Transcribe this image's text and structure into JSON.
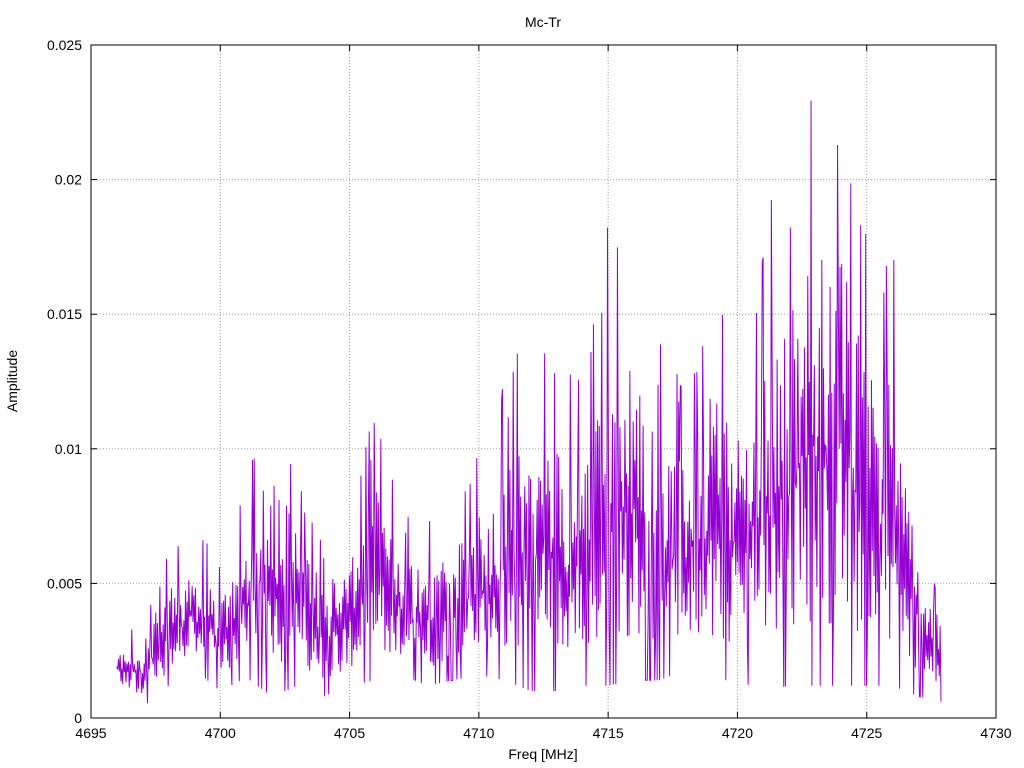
{
  "chart_data": {
    "type": "line",
    "title": "Mc-Tr",
    "xlabel": "Freq [MHz]",
    "ylabel": "Amplitude",
    "xlim": [
      4695,
      4730
    ],
    "ylim": [
      0,
      0.025
    ],
    "x_ticks": [
      "4695",
      "4700",
      "4705",
      "4710",
      "4715",
      "4720",
      "4725",
      "4730"
    ],
    "y_ticks": [
      "0",
      "0.005",
      "0.01",
      "0.015",
      "0.02",
      "0.025"
    ],
    "grid": true,
    "series": [
      {
        "color": "#9400d3",
        "x_start": 4696.0,
        "x_step": 0.032,
        "envelope_x": [
          4696.0,
          4697.0,
          4698.0,
          4699.0,
          4700.0,
          4701.0,
          4702.0,
          4703.0,
          4704.0,
          4705.0,
          4706.0,
          4707.0,
          4708.0,
          4709.0,
          4710.0,
          4711.0,
          4712.0,
          4713.0,
          4714.0,
          4715.0,
          4716.0,
          4717.0,
          4718.0,
          4719.0,
          4720.0,
          4721.0,
          4722.0,
          4723.0,
          4724.0,
          4725.0,
          4726.0,
          4727.0,
          4727.9
        ],
        "envelope_min": [
          0.001,
          0.0004,
          0.0012,
          0.0018,
          0.001,
          0.0015,
          0.0008,
          0.0012,
          0.0008,
          0.0012,
          0.0014,
          0.0016,
          0.0012,
          0.0014,
          0.0016,
          0.0014,
          0.001,
          0.001,
          0.0012,
          0.0012,
          0.0014,
          0.0014,
          0.0018,
          0.0014,
          0.0014,
          0.001,
          0.0012,
          0.0012,
          0.0012,
          0.0012,
          0.0012,
          0.0008,
          0.0006
        ],
        "envelope_max": [
          0.003,
          0.004,
          0.0065,
          0.007,
          0.006,
          0.0088,
          0.0132,
          0.0095,
          0.0068,
          0.0075,
          0.0118,
          0.0078,
          0.0078,
          0.0085,
          0.0101,
          0.0125,
          0.0148,
          0.0142,
          0.0125,
          0.0185,
          0.018,
          0.0142,
          0.0125,
          0.0175,
          0.014,
          0.019,
          0.021,
          0.0242,
          0.0242,
          0.0185,
          0.0177,
          0.008,
          0.0045
        ]
      }
    ]
  }
}
